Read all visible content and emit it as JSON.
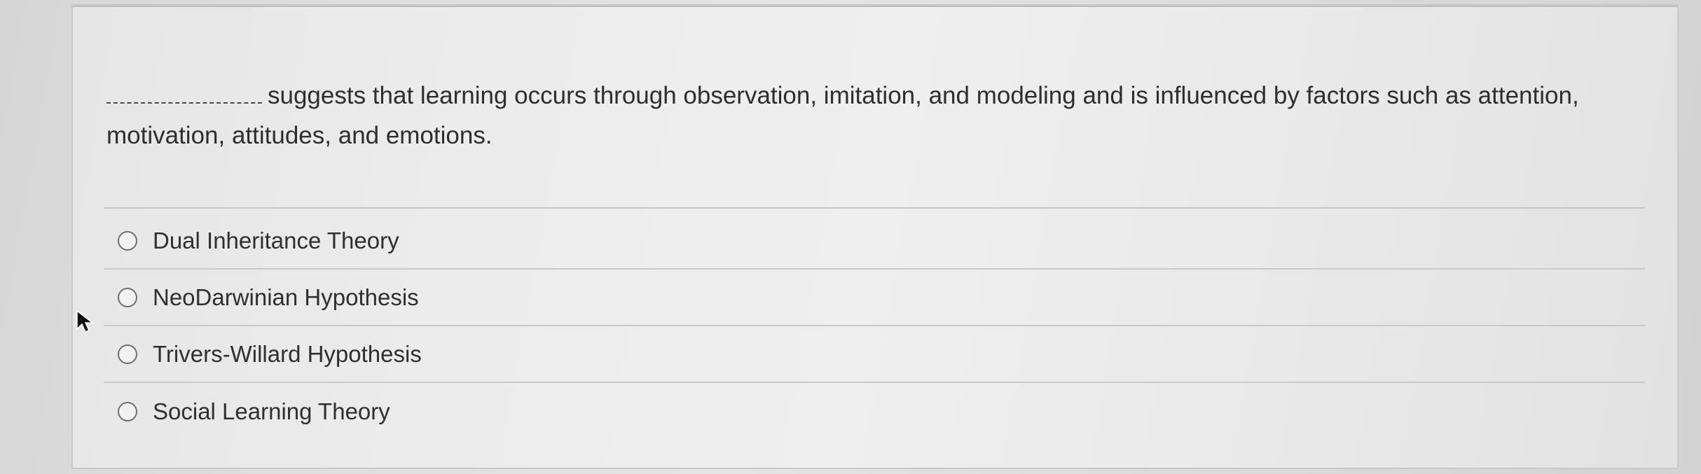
{
  "question": {
    "blank": "",
    "text": "suggests that learning occurs through observation, imitation, and modeling and is influenced by factors such as attention, motivation, attitudes, and emotions."
  },
  "options": [
    {
      "label": "Dual Inheritance Theory",
      "selected": false
    },
    {
      "label": "NeoDarwinian Hypothesis",
      "selected": false
    },
    {
      "label": "Trivers-Willard Hypothesis",
      "selected": false
    },
    {
      "label": "Social Learning Theory",
      "selected": false
    }
  ],
  "icons": {
    "cursor": "mouse-pointer-icon",
    "radio": "radio-button-icon"
  },
  "colors": {
    "text": "#2e2e2e",
    "border": "#c9c9c9",
    "background": "#e6e6e6"
  }
}
